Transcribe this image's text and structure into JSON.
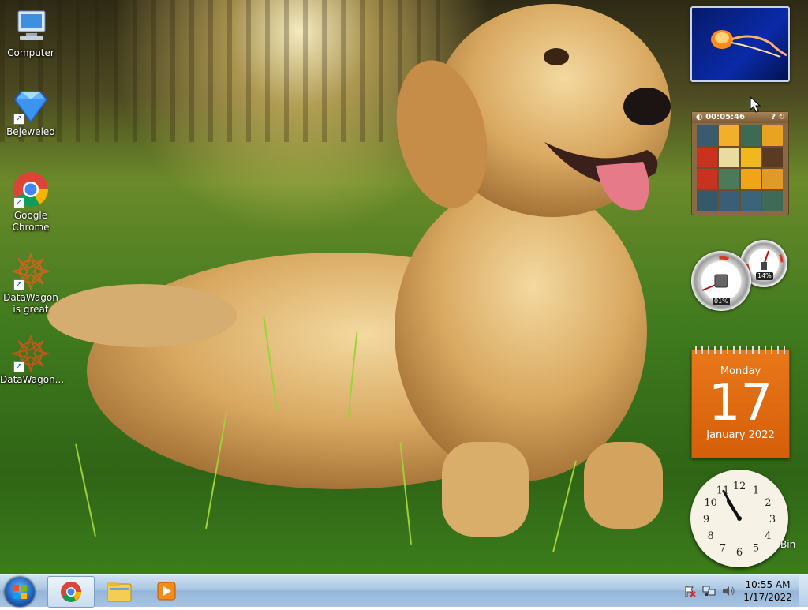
{
  "desktop": {
    "icons": [
      {
        "label": "Computer",
        "icon": "computer-icon"
      },
      {
        "label": "Bejeweled",
        "icon": "diamond-icon"
      },
      {
        "label": "Google Chrome",
        "icon": "chrome-icon"
      },
      {
        "label": "DataWagon is great",
        "icon": "datawagon-icon"
      },
      {
        "label": "DataWagon...",
        "icon": "datawagon-icon"
      }
    ],
    "recycle_bin_partial_label": "Bin"
  },
  "gadgets": {
    "slideshow": {
      "icon": "jellyfish-photo"
    },
    "puzzle": {
      "timer": "00:05:46"
    },
    "cpu_meter": {
      "cpu_percent": "01%",
      "memory_percent": "14%"
    },
    "calendar": {
      "weekday": "Monday",
      "day": "17",
      "month_year": "January 2022"
    },
    "clock": {
      "numerals": [
        "12",
        "1",
        "2",
        "3",
        "4",
        "5",
        "6",
        "7",
        "8",
        "9",
        "10",
        "11"
      ],
      "hour": 10,
      "minute": 55
    }
  },
  "taskbar": {
    "start_icon": "windows-logo-icon",
    "pinned": [
      {
        "name": "chrome",
        "icon": "chrome-icon",
        "active": true
      },
      {
        "name": "explorer",
        "icon": "folder-icon",
        "active": false
      },
      {
        "name": "media-player",
        "icon": "media-player-icon",
        "active": false
      }
    ],
    "tray": {
      "time": "10:55 AM",
      "date": "1/17/2022"
    }
  },
  "colors": {
    "taskbar": "#a9c6e3",
    "calendar": "#e06a10",
    "accent": "#1b5fb8"
  }
}
